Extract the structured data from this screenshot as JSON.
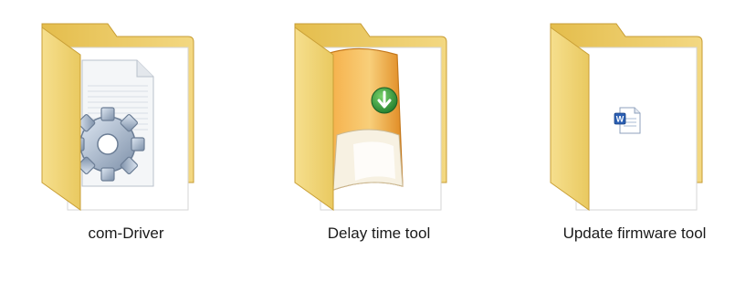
{
  "folders": [
    {
      "label": "com-Driver",
      "icon": "folder-gear-document-icon"
    },
    {
      "label": "Delay time tool",
      "icon": "folder-installer-box-icon"
    },
    {
      "label": "Update firmware tool",
      "icon": "folder-word-document-icon"
    }
  ],
  "colors": {
    "folder_front": "#f1d77c",
    "folder_back": "#e8c457",
    "folder_edge": "#d2a83a",
    "label_text": "#1a1a1a"
  }
}
